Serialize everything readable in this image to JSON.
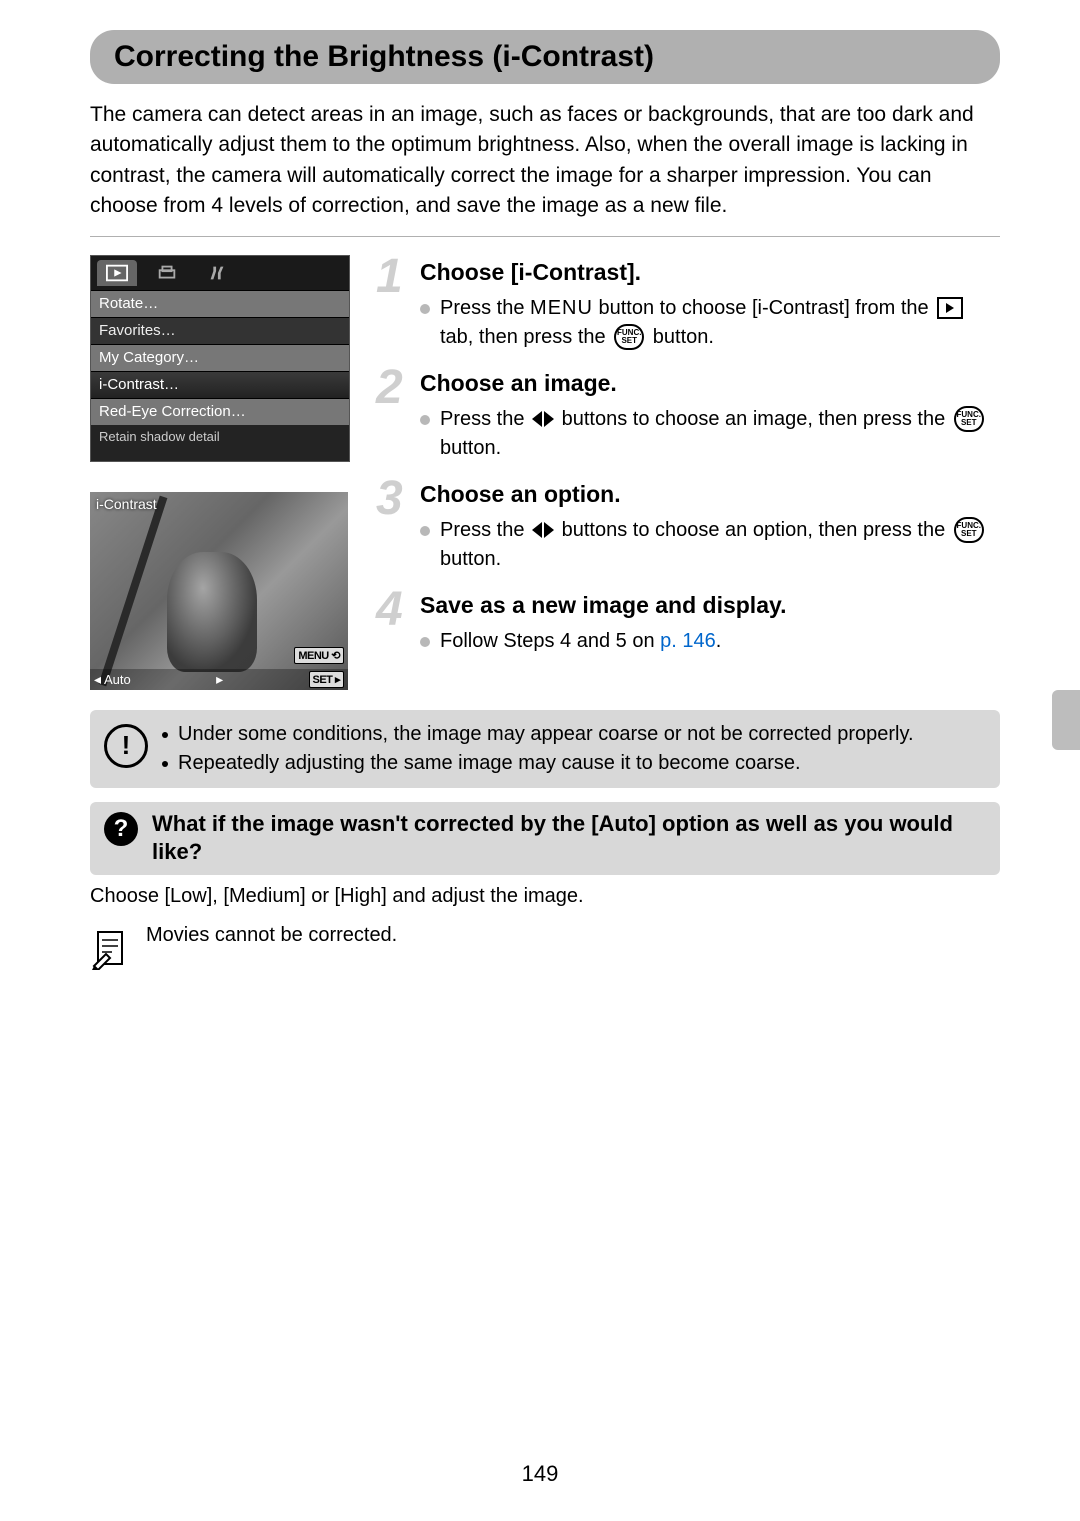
{
  "title": "Correcting the Brightness (i-Contrast)",
  "intro": "The camera can detect areas in an image, such as faces or backgrounds, that are too dark and automatically adjust them to the optimum brightness. Also, when the overall image is lacking in contrast, the camera will automatically correct the image for a sharper impression. You can choose from 4 levels of correction, and save the image as a new file.",
  "camMenu": {
    "items": [
      "Rotate…",
      "Favorites…",
      "My Category…",
      "i-Contrast…",
      "Red-Eye Correction…"
    ],
    "description": "Retain shadow detail"
  },
  "preview": {
    "topLabel": "i-Contrast",
    "mode": "Auto",
    "menuBadge": "MENU",
    "setBadge": "SET"
  },
  "steps": [
    {
      "num": "1",
      "title": "Choose [i-Contrast].",
      "pre1": "Press the ",
      "menuWord": "MENU",
      "mid1": " button to choose [i-Contrast] from the ",
      "mid2": " tab, then press the ",
      "post1": " button."
    },
    {
      "num": "2",
      "title": "Choose an image.",
      "pre": "Press the ",
      "mid": " buttons to choose an image, then press the ",
      "post": " button."
    },
    {
      "num": "3",
      "title": "Choose an option.",
      "pre": "Press the ",
      "mid": " buttons to choose an option, then press the ",
      "post": " button."
    },
    {
      "num": "4",
      "title": "Save as a new image and display.",
      "text": "Follow Steps 4 and 5 on ",
      "link": "p. 146",
      "post": "."
    }
  ],
  "caution": {
    "b1": "Under some conditions, the image may appear coarse or not be corrected properly.",
    "b2": "Repeatedly adjusting the same image may cause it to become coarse."
  },
  "question": "What if the image wasn't corrected by the [Auto] option as well as you would like?",
  "answer": "Choose [Low], [Medium] or [High] and adjust the image.",
  "pencilNote": "Movies cannot be corrected.",
  "funcset": {
    "top": "FUNC.",
    "bot": "SET"
  },
  "pageNumber": "149"
}
